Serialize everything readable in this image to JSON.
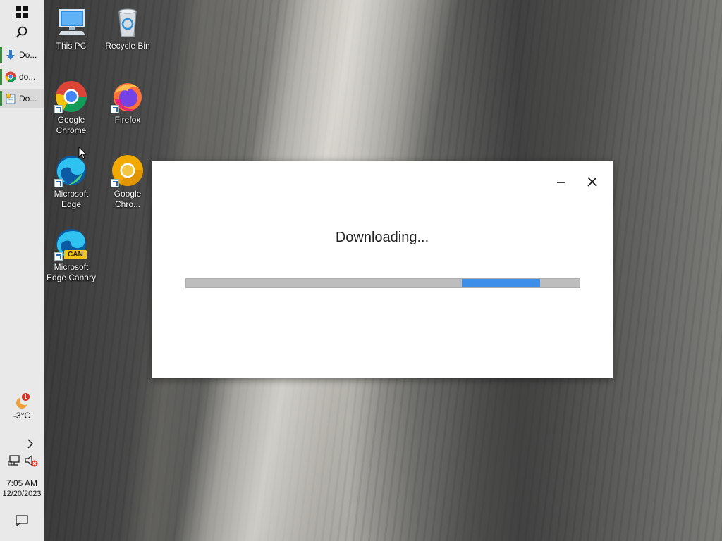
{
  "taskbar": {
    "start_icon": "windows-logo-icon",
    "search_icon": "search-icon",
    "apps": [
      {
        "label": "Do...",
        "icon": "download-arrow-icon",
        "active": false
      },
      {
        "label": "do...",
        "icon": "chrome-icon",
        "active": false
      },
      {
        "label": "Do...",
        "icon": "installer-icon",
        "active": true
      }
    ],
    "weather": {
      "temp": "-3°C",
      "badge": "1"
    },
    "clock": {
      "time": "7:05 AM",
      "date": "12/20/2023"
    }
  },
  "desktop": {
    "icons": [
      {
        "label": "This PC"
      },
      {
        "label": "Recycle Bin"
      },
      {
        "label": "Google Chrome"
      },
      {
        "label": "Firefox"
      },
      {
        "label": "Microsoft Edge"
      },
      {
        "label": "Google Chro..."
      },
      {
        "label": "Microsoft Edge Canary",
        "badge": "CAN"
      }
    ]
  },
  "dialog": {
    "title": "Downloading...",
    "progress": {
      "mode": "indeterminate",
      "chunk_start": 0.7,
      "chunk_end": 0.9
    },
    "colors": {
      "track": "#bdbdbd",
      "chunk": "#3d8ee8"
    }
  }
}
